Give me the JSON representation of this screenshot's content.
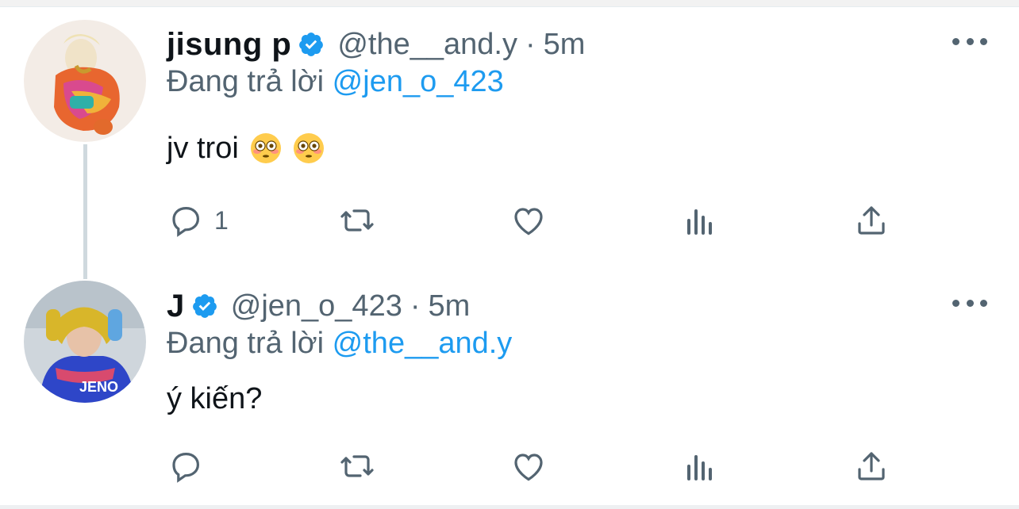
{
  "tweets": [
    {
      "display_name": "jisung p",
      "handle": "@the__and.y",
      "separator": "·",
      "time": "5m",
      "replying_prefix": "Đang trả lời",
      "replying_to": "@jen_o_423",
      "text": "jv troi",
      "emoji": [
        "flushed-face",
        "flushed-face"
      ],
      "reply_count": "1",
      "actions": [
        "reply",
        "retweet",
        "like",
        "analytics",
        "share"
      ]
    },
    {
      "display_name": "J",
      "handle": "@jen_o_423",
      "separator": "·",
      "time": "5m",
      "replying_prefix": "Đang trả lời",
      "replying_to": "@the__and.y",
      "text": "ý kiến?",
      "reply_count": "",
      "actions": [
        "reply",
        "retweet",
        "like",
        "analytics",
        "share"
      ]
    }
  ],
  "colors": {
    "link": "#1d9bf0",
    "muted": "#536471",
    "verified": "#1d9bf0",
    "thread_line": "#cfd9de"
  }
}
